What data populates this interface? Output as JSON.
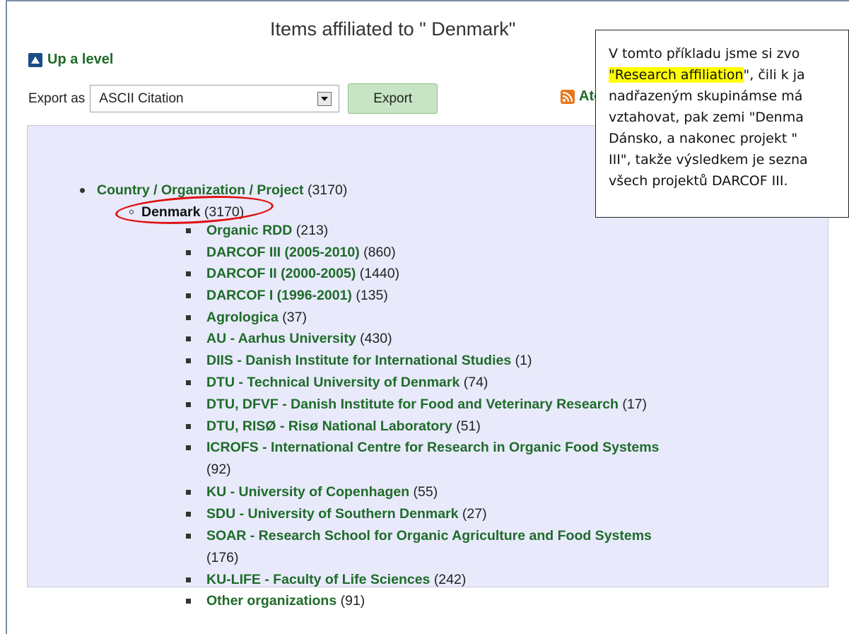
{
  "page": {
    "title": "Items affiliated to \" Denmark\"",
    "up_level": "Up a level",
    "export_label": "Export as",
    "export_format": "ASCII Citation",
    "export_button": "Export",
    "atom_label": "Ato"
  },
  "tree": {
    "root": {
      "name": "Country / Organization / Project",
      "count": "(3170)"
    },
    "selected": {
      "name": "Denmark",
      "count": "(3170)"
    },
    "items": [
      {
        "name": "Organic RDD",
        "count": "(213)"
      },
      {
        "name": "DARCOF III (2005-2010)",
        "count": "(860)"
      },
      {
        "name": "DARCOF II (2000-2005)",
        "count": "(1440)"
      },
      {
        "name": "DARCOF I (1996-2001)",
        "count": "(135)"
      },
      {
        "name": "Agrologica",
        "count": "(37)"
      },
      {
        "name": "AU - Aarhus University",
        "count": "(430)"
      },
      {
        "name": "DIIS - Danish Institute for International Studies",
        "count": "(1)"
      },
      {
        "name": "DTU - Technical University of Denmark",
        "count": "(74)"
      },
      {
        "name": "DTU, DFVF - Danish Institute for Food and Veterinary Research",
        "count": "(17)"
      },
      {
        "name": "DTU, RISØ - Risø National Laboratory",
        "count": "(51)"
      },
      {
        "name": "ICROFS - International Centre for Research in Organic Food Systems",
        "count": "(92)"
      },
      {
        "name": "KU - University of Copenhagen",
        "count": "(55)"
      },
      {
        "name": "SDU - University of Southern Denmark",
        "count": "(27)"
      },
      {
        "name": "SOAR - Research School for Organic Agriculture and Food Systems",
        "count": "(176)"
      },
      {
        "name": "KU-LIFE - Faculty of Life Sciences",
        "count": "(242)"
      },
      {
        "name": "Other organizations",
        "count": "(91)"
      }
    ]
  },
  "callout": {
    "line1": "V tomto příkladu jsme si zvo",
    "line2_highlight": "\"Research affiliation",
    "line2_rest": "\", čili k ja",
    "line3": "nadřazeným skupinámse má",
    "line4": "vztahovat, pak zemi \"Denma",
    "line5": "Dánsko, a nakonec projekt \"",
    "line6": "III\", takže výsledkem je sezna",
    "line7": "všech projektů DARCOF III."
  },
  "colors": {
    "link_green": "#1f6b2a",
    "panel_bg": "#e8eafb",
    "export_button_bg": "#c7e4c4",
    "annotation_red": "#e01010",
    "highlight_yellow": "#ffff00",
    "up_icon_blue": "#1a4f86",
    "rss_orange": "#e8751a"
  },
  "icons": {
    "up_level": "up-arrow-icon",
    "select_arrow": "dropdown-arrow-icon",
    "feed": "rss-feed-icon"
  }
}
